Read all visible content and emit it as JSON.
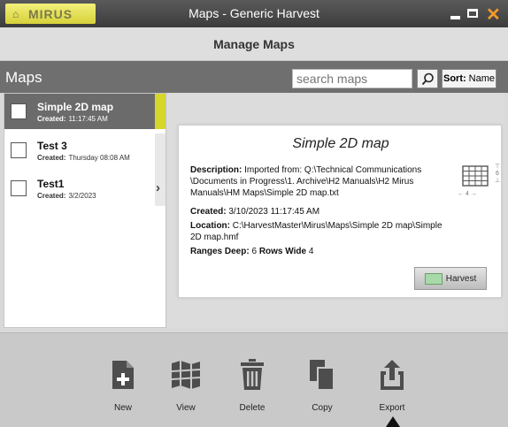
{
  "window": {
    "brand": "MIRUS",
    "title": "Maps - Generic Harvest"
  },
  "header": {
    "title": "Manage Maps"
  },
  "toolbar": {
    "title": "Maps",
    "search_placeholder": "search maps",
    "sort_label": "Sort:",
    "sort_value": "Name"
  },
  "maps": [
    {
      "name": "Simple 2D map",
      "created_label": "Created:",
      "created": "11:17:45 AM",
      "selected": true
    },
    {
      "name": "Test 3",
      "created_label": "Created:",
      "created": "Thursday 08:08 AM",
      "selected": false
    },
    {
      "name": "Test1",
      "created_label": "Created:",
      "created": "3/2/2023",
      "selected": false
    }
  ],
  "detail": {
    "title": "Simple 2D map",
    "description_label": "Description:",
    "description": "Imported from: Q:\\Technical Communications \\Documents in Progress\\1. Archive\\H2 Manuals\\H2 Mirus Manuals\\HM Maps\\Simple 2D map.txt",
    "created_label": "Created:",
    "created": "3/10/2023 11:17:45 AM",
    "location_label": "Location:",
    "location": "C:\\HarvestMaster\\Mirus\\Maps\\Simple 2D map\\Simple 2D map.hmf",
    "ranges_label": "Ranges Deep:",
    "ranges": "6",
    "rows_label": "Rows Wide",
    "rows": "4",
    "grid_rows": "6",
    "grid_cols": "4",
    "harvest_label": "Harvest"
  },
  "actions": [
    {
      "label": "New",
      "icon": "new-document-icon"
    },
    {
      "label": "View",
      "icon": "map-view-icon"
    },
    {
      "label": "Delete",
      "icon": "trash-icon"
    },
    {
      "label": "Copy",
      "icon": "copy-icon"
    },
    {
      "label": "Export",
      "icon": "export-icon"
    }
  ],
  "colors": {
    "accent": "#d4d62a",
    "toolbar": "#6f6f6f",
    "selected_item": "#6b6b6b",
    "close": "#f39a2a"
  }
}
